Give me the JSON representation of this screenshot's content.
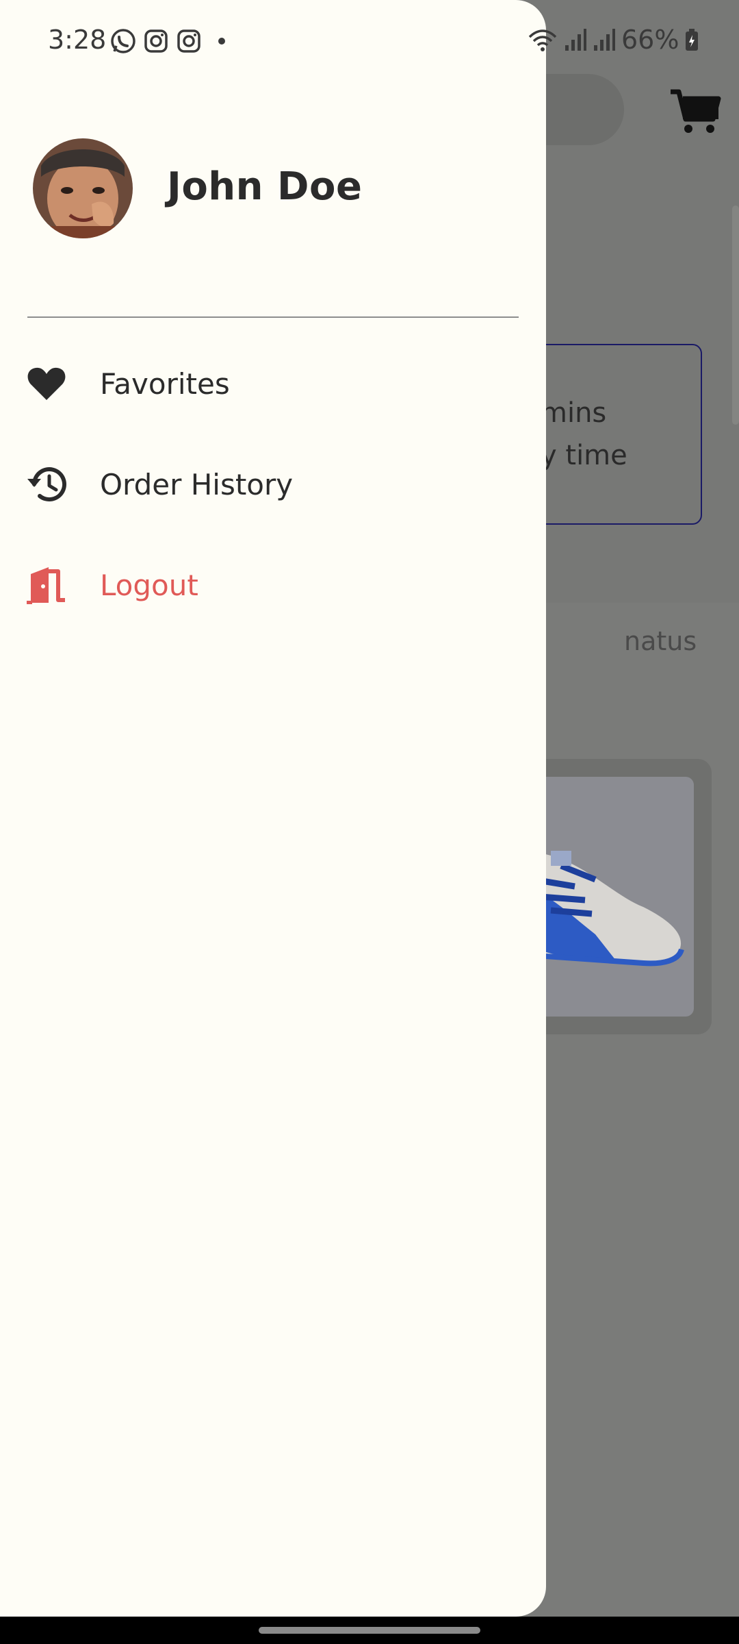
{
  "status_bar": {
    "time": "3:28",
    "battery": "66%",
    "left_icons": [
      "whatsapp-icon",
      "instagram-icon",
      "instagram-icon",
      "notification-dot-icon"
    ],
    "right_icons": [
      "wifi-icon",
      "signal-icon",
      "signal-icon",
      "battery-icon"
    ]
  },
  "drawer": {
    "user": {
      "name": "John Doe",
      "avatar_icon": "avatar"
    },
    "menu": [
      {
        "label": "Favorites",
        "icon": "heart-icon"
      },
      {
        "label": "Order History",
        "icon": "history-icon"
      },
      {
        "label": "Logout",
        "icon": "door-exit-icon",
        "color": "#e05a57"
      }
    ]
  },
  "background_app": {
    "card_lines": [
      "mins",
      "y time"
    ],
    "tab_label": "natus",
    "product_icon": "sneaker-image",
    "cart_icon": "cart-icon"
  },
  "colors": {
    "drawer_bg": "#fefdf6",
    "scrim": "#777876",
    "logout": "#e05a57",
    "text": "#2b2b2b"
  }
}
